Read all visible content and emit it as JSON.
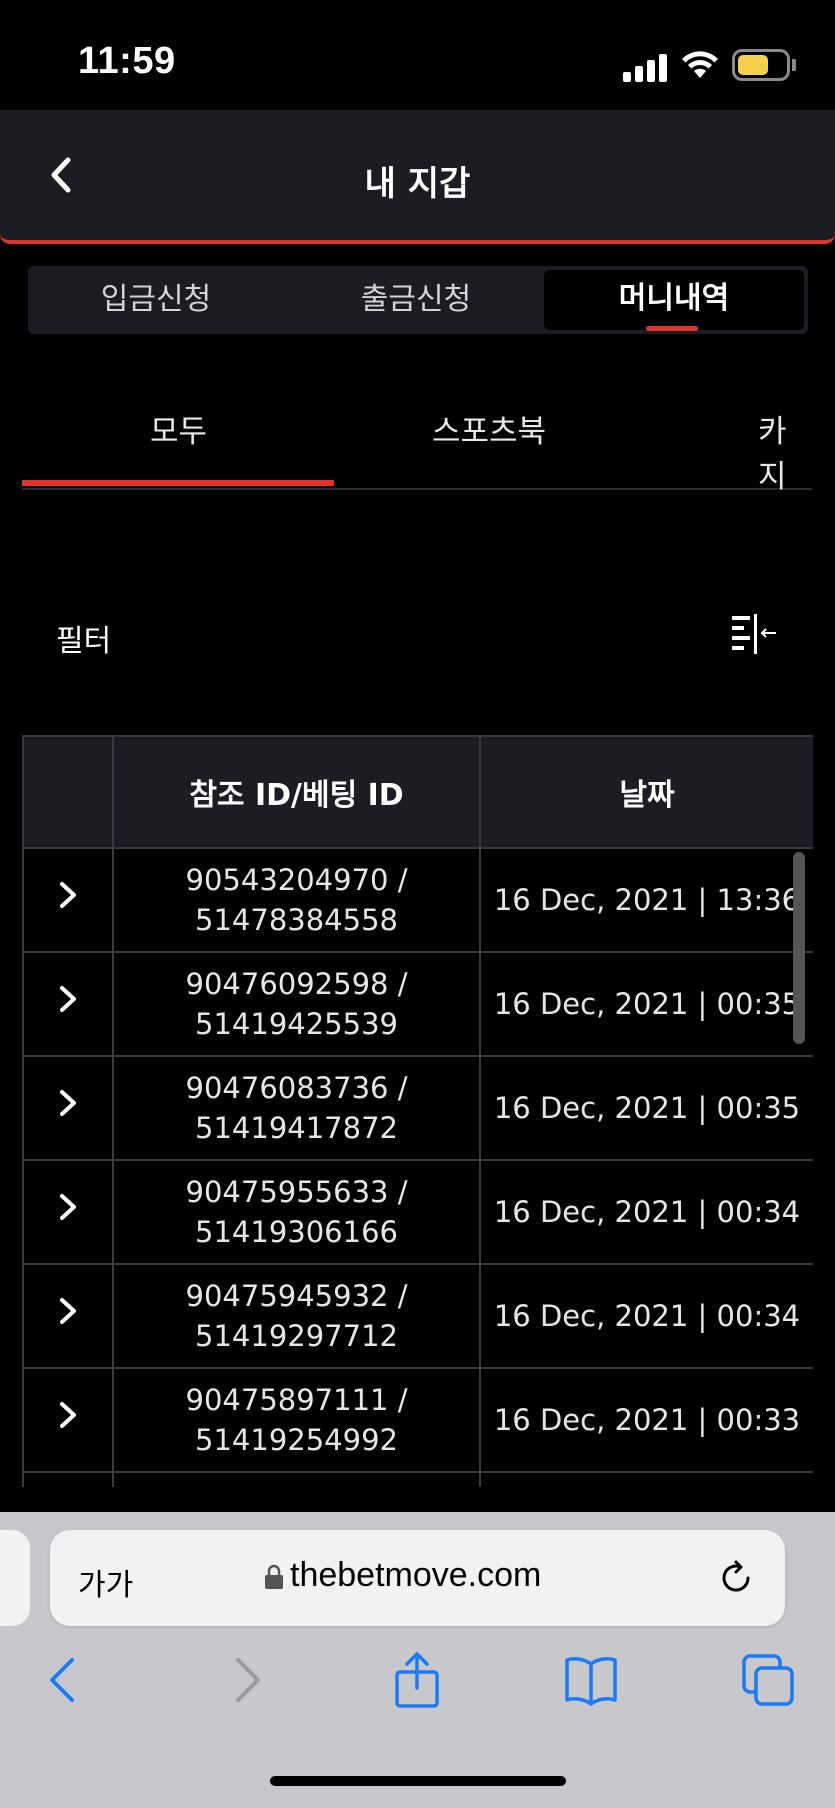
{
  "status": {
    "time": "11:59"
  },
  "header": {
    "title": "내 지갑"
  },
  "segments": [
    {
      "label": "입금신청"
    },
    {
      "label": "출금신청"
    },
    {
      "label": "머니내역"
    }
  ],
  "subtabs": [
    {
      "label": "모두"
    },
    {
      "label": "스포츠북"
    },
    {
      "label": "카지"
    }
  ],
  "filter": {
    "label": "필터"
  },
  "table": {
    "headers": [
      "",
      "참조 ID/베팅 ID",
      "날짜"
    ],
    "rows": [
      {
        "ref_id": "90543204970 /",
        "bet_id": "51478384558",
        "date": "16 Dec, 2021 | 13:36"
      },
      {
        "ref_id": "90476092598 /",
        "bet_id": "51419425539",
        "date": "16 Dec, 2021 | 00:35"
      },
      {
        "ref_id": "90476083736 /",
        "bet_id": "51419417872",
        "date": "16 Dec, 2021 | 00:35"
      },
      {
        "ref_id": "90475955633 /",
        "bet_id": "51419306166",
        "date": "16 Dec, 2021 | 00:34"
      },
      {
        "ref_id": "90475945932 /",
        "bet_id": "51419297712",
        "date": "16 Dec, 2021 | 00:34"
      },
      {
        "ref_id": "90475897111 /",
        "bet_id": "51419254992",
        "date": "16 Dec, 2021 | 00:33"
      }
    ]
  },
  "browser": {
    "text_size_label": "가가",
    "url": "thebetmove.com"
  },
  "colors": {
    "accent": "#e2332b",
    "ios_blue": "#1a7cf5",
    "surface": "#1b1d22"
  }
}
